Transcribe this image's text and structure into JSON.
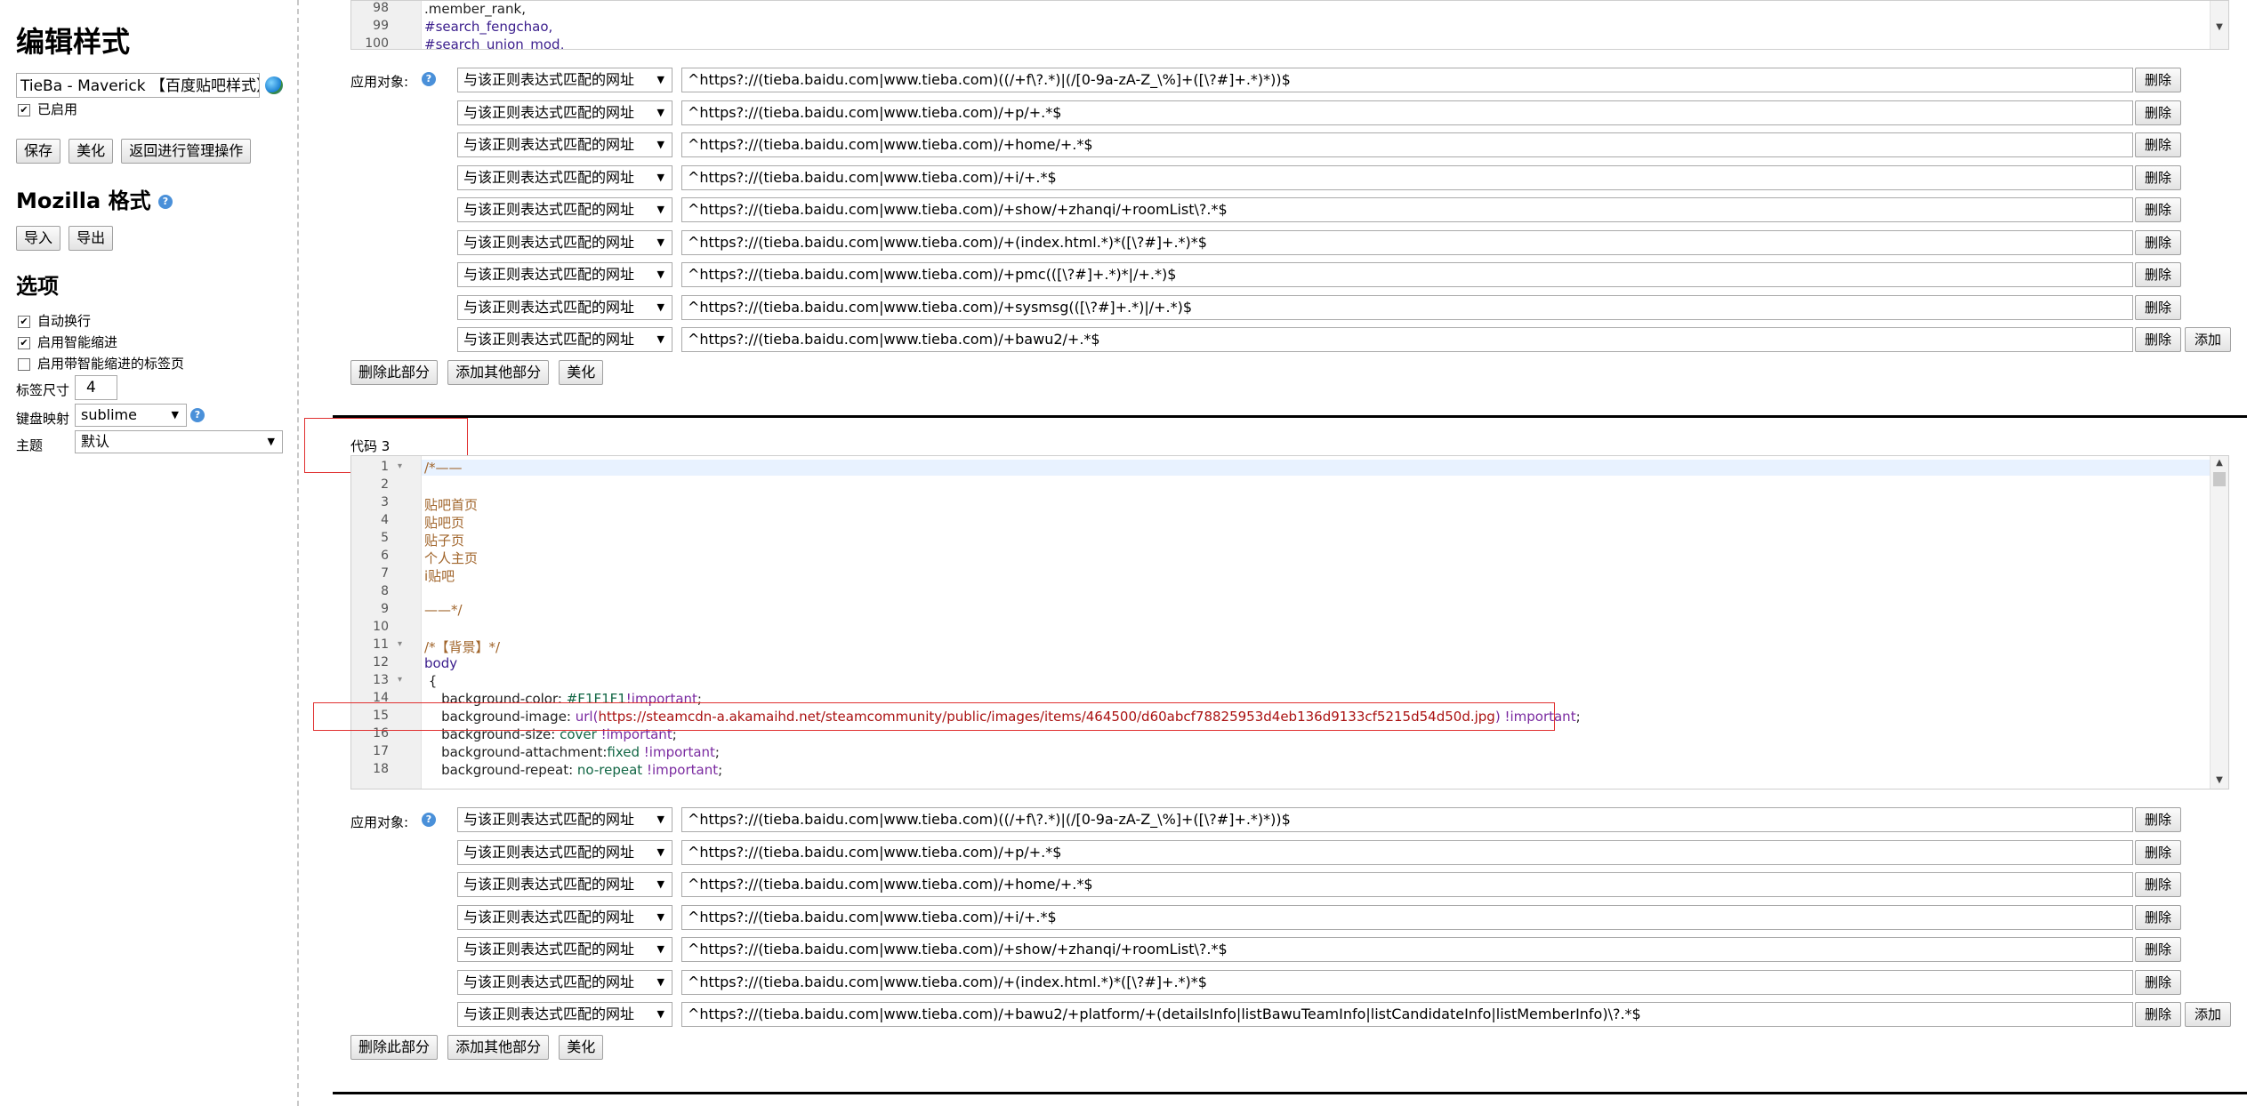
{
  "sidebar": {
    "title": "编辑样式",
    "style_name": "TieBa - Maverick 【百度贴吧样式】",
    "enabled_label": "已启用",
    "enabled": true,
    "buttons": {
      "save": "保存",
      "beautify": "美化",
      "back": "返回进行管理操作"
    },
    "mozilla_title": "Mozilla 格式",
    "import": "导入",
    "export": "导出",
    "options_title": "选项",
    "options": [
      {
        "label": "自动换行",
        "checked": true
      },
      {
        "label": "启用智能缩进",
        "checked": true
      },
      {
        "label": "启用带智能缩进的标签页",
        "checked": false
      }
    ],
    "tab_size_label": "标签尺寸",
    "tab_size": "4",
    "keymap_label": "键盘映射",
    "keymap": "sublime",
    "theme_label": "主题",
    "theme": "默认"
  },
  "section2": {
    "code_tail": [
      {
        "n": "98",
        "text": ".member_rank,"
      },
      {
        "n": "99",
        "text": "#search_fengchao,"
      },
      {
        "n": "100",
        "text": "#search_union_mod,"
      }
    ],
    "apply_label": "应用对象:",
    "rows": [
      {
        "type": "与该正则表达式匹配的网址",
        "value": "^https?://(tieba.baidu.com|www.tieba.com)((/+f\\?.*)|(/[0-9a-zA-Z_\\%]+([\\?#]+.*)*))$",
        "delete": "删除"
      },
      {
        "type": "与该正则表达式匹配的网址",
        "value": "^https?://(tieba.baidu.com|www.tieba.com)/+p/+.*$",
        "delete": "删除"
      },
      {
        "type": "与该正则表达式匹配的网址",
        "value": "^https?://(tieba.baidu.com|www.tieba.com)/+home/+.*$",
        "delete": "删除"
      },
      {
        "type": "与该正则表达式匹配的网址",
        "value": "^https?://(tieba.baidu.com|www.tieba.com)/+i/+.*$",
        "delete": "删除"
      },
      {
        "type": "与该正则表达式匹配的网址",
        "value": "^https?://(tieba.baidu.com|www.tieba.com)/+show/+zhanqi/+roomList\\?.*$",
        "delete": "删除"
      },
      {
        "type": "与该正则表达式匹配的网址",
        "value": "^https?://(tieba.baidu.com|www.tieba.com)/+(index.html.*)*([\\?#]+.*)*$",
        "delete": "删除"
      },
      {
        "type": "与该正则表达式匹配的网址",
        "value": "^https?://(tieba.baidu.com|www.tieba.com)/+pmc(([\\?#]+.*)*|/+.*)$",
        "delete": "删除"
      },
      {
        "type": "与该正则表达式匹配的网址",
        "value": "^https?://(tieba.baidu.com|www.tieba.com)/+sysmsg(([\\?#]+.*)|/+.*)$",
        "delete": "删除"
      },
      {
        "type": "与该正则表达式匹配的网址",
        "value": "^https?://(tieba.baidu.com|www.tieba.com)/+bawu2/+.*$",
        "delete": "删除",
        "add": "添加"
      }
    ],
    "actions": {
      "delete_section": "删除此部分",
      "add_section": "添加其他部分",
      "beautify": "美化"
    }
  },
  "section3": {
    "label": "代码 3",
    "code": [
      {
        "n": "1",
        "fold": "▾",
        "text": "/*——",
        "cls": "c-com"
      },
      {
        "n": "2",
        "text": ""
      },
      {
        "n": "3",
        "text": "贴吧首页",
        "cls": "c-com"
      },
      {
        "n": "4",
        "text": "贴吧页",
        "cls": "c-com"
      },
      {
        "n": "5",
        "text": "贴子页",
        "cls": "c-com"
      },
      {
        "n": "6",
        "text": "个人主页",
        "cls": "c-com"
      },
      {
        "n": "7",
        "text": "i贴吧",
        "cls": "c-com"
      },
      {
        "n": "8",
        "text": ""
      },
      {
        "n": "9",
        "text": "——*/",
        "cls": "c-com"
      },
      {
        "n": "10",
        "text": ""
      },
      {
        "n": "11",
        "fold": "▾",
        "text": "/*【背景】*/",
        "cls": "c-com"
      },
      {
        "n": "12",
        "text": "body",
        "cls": "c-sel"
      },
      {
        "n": "13",
        "fold": "▾",
        "text": " {",
        "cls": "c-txt"
      },
      {
        "n": "14",
        "prop": "    background-color: ",
        "val": "#F1F1F1",
        "imp": "!important",
        "tail": ";"
      },
      {
        "n": "15",
        "prop": "    background-image: ",
        "fn": "url(",
        "url": "https://steamcdn-a.akamaihd.net/steamcommunity/public/images/items/464500/d60abcf78825953d4eb136d9133cf5215d54d50d.jpg",
        "fnend": ") ",
        "imp": "!important",
        "tail": ";"
      },
      {
        "n": "16",
        "prop": "    background-size: ",
        "val": "cover ",
        "imp": "!important",
        "tail": ";"
      },
      {
        "n": "17",
        "prop": "    background-attachment:",
        "val": "fixed ",
        "imp": "!important",
        "tail": ";"
      },
      {
        "n": "18",
        "prop": "    background-repeat: ",
        "val": "no-repeat ",
        "imp": "!important",
        "tail": ";"
      }
    ],
    "apply_label": "应用对象:",
    "rows": [
      {
        "type": "与该正则表达式匹配的网址",
        "value": "^https?://(tieba.baidu.com|www.tieba.com)((/+f\\?.*)|(/[0-9a-zA-Z_\\%]+([\\?#]+.*)*))$",
        "delete": "删除"
      },
      {
        "type": "与该正则表达式匹配的网址",
        "value": "^https?://(tieba.baidu.com|www.tieba.com)/+p/+.*$",
        "delete": "删除"
      },
      {
        "type": "与该正则表达式匹配的网址",
        "value": "^https?://(tieba.baidu.com|www.tieba.com)/+home/+.*$",
        "delete": "删除"
      },
      {
        "type": "与该正则表达式匹配的网址",
        "value": "^https?://(tieba.baidu.com|www.tieba.com)/+i/+.*$",
        "delete": "删除"
      },
      {
        "type": "与该正则表达式匹配的网址",
        "value": "^https?://(tieba.baidu.com|www.tieba.com)/+show/+zhanqi/+roomList\\?.*$",
        "delete": "删除"
      },
      {
        "type": "与该正则表达式匹配的网址",
        "value": "^https?://(tieba.baidu.com|www.tieba.com)/+(index.html.*)*([\\?#]+.*)*$",
        "delete": "删除"
      },
      {
        "type": "与该正则表达式匹配的网址",
        "value": "^https?://(tieba.baidu.com|www.tieba.com)/+bawu2/+platform/+(detailsInfo|listBawuTeamInfo|listCandidateInfo|listMemberInfo)\\?.*$",
        "delete": "删除",
        "add": "添加"
      }
    ],
    "actions": {
      "delete_section": "删除此部分",
      "add_section": "添加其他部分",
      "beautify": "美化"
    }
  }
}
